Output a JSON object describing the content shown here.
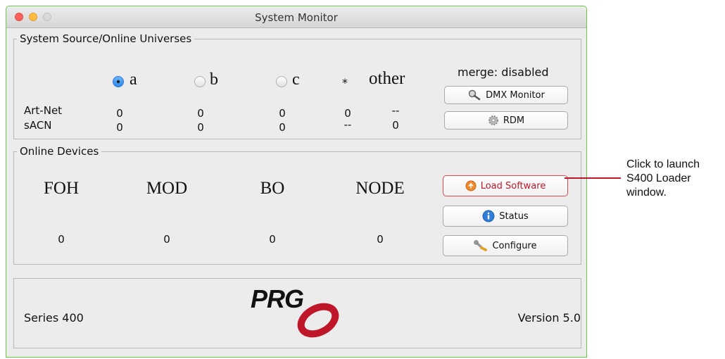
{
  "window": {
    "title": "System Monitor"
  },
  "universes": {
    "legend": "System Source/Online Universes",
    "radios": [
      {
        "label": "a",
        "selected": true
      },
      {
        "label": "b",
        "selected": false
      },
      {
        "label": "c",
        "selected": false
      }
    ],
    "star_label": "*",
    "other_label": "other",
    "merge_status": "merge: disabled",
    "rows": [
      {
        "label": "Art-Net",
        "values": [
          "0",
          "0",
          "0",
          "0",
          "--"
        ]
      },
      {
        "label": "sACN",
        "values": [
          "0",
          "0",
          "0",
          "--",
          "0"
        ]
      }
    ],
    "buttons": {
      "dmx_monitor": "DMX Monitor",
      "rdm": "RDM"
    }
  },
  "devices": {
    "legend": "Online Devices",
    "columns": [
      {
        "name": "FOH",
        "count": "0"
      },
      {
        "name": "MOD",
        "count": "0"
      },
      {
        "name": "BO",
        "count": "0"
      },
      {
        "name": "NODE",
        "count": "0"
      }
    ],
    "buttons": {
      "load_software": "Load Software",
      "status": "Status",
      "configure": "Configure"
    }
  },
  "footer": {
    "series": "Series 400",
    "logo_text": "PRG",
    "version": "Version 5.0"
  },
  "callout": {
    "lines": [
      "Click to launch",
      "S400 Loader",
      "window."
    ]
  },
  "colors": {
    "highlight": "#c0162a",
    "radio_selected": "#2f86ea",
    "window_border": "#6cc644"
  }
}
